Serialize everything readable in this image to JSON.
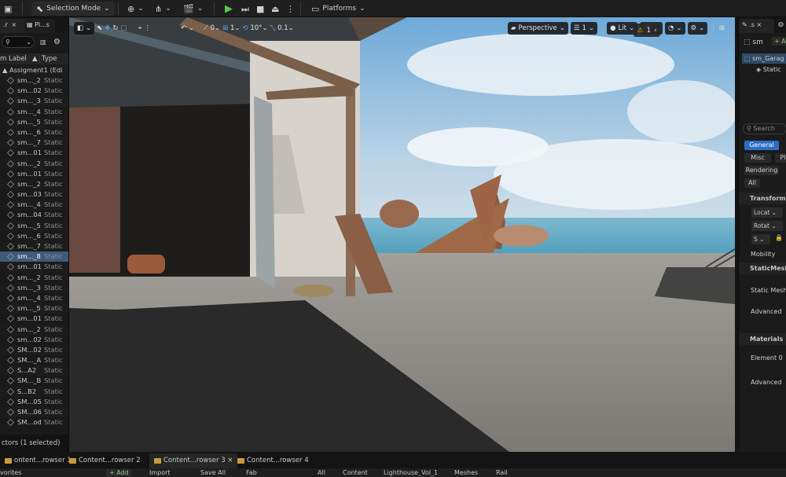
{
  "toolbar": {
    "selection_mode": "Selection Mode",
    "platforms": "Platforms"
  },
  "outliner": {
    "tabs": [
      ".r",
      "Pl...s"
    ],
    "close": "×",
    "search_placeholder": "",
    "column_label": "m Label",
    "column_type": "Type",
    "root": "Assigment1 (Edi",
    "rows": [
      {
        "name": "sm..._2",
        "type": "Static"
      },
      {
        "name": "sm...02",
        "type": "Static"
      },
      {
        "name": "sm..._3",
        "type": "Static"
      },
      {
        "name": "sm..._4",
        "type": "Static"
      },
      {
        "name": "sm..._5",
        "type": "Static"
      },
      {
        "name": "sm..._6",
        "type": "Static"
      },
      {
        "name": "sm..._7",
        "type": "Static"
      },
      {
        "name": "sm...01",
        "type": "Static"
      },
      {
        "name": "sm..._2",
        "type": "Static"
      },
      {
        "name": "sm...01",
        "type": "Static"
      },
      {
        "name": "sm..._2",
        "type": "Static"
      },
      {
        "name": "sm...03",
        "type": "Static"
      },
      {
        "name": "sm..._4",
        "type": "Static"
      },
      {
        "name": "sm...04",
        "type": "Static"
      },
      {
        "name": "sm..._5",
        "type": "Static"
      },
      {
        "name": "sm..._6",
        "type": "Static"
      },
      {
        "name": "sm..._7",
        "type": "Static"
      },
      {
        "name": "sm..._8",
        "type": "Static",
        "selected": true
      },
      {
        "name": "sm...01",
        "type": "Static"
      },
      {
        "name": "sm..._2",
        "type": "Static"
      },
      {
        "name": "sm..._3",
        "type": "Static"
      },
      {
        "name": "sm..._4",
        "type": "Static"
      },
      {
        "name": "sm..._5",
        "type": "Static"
      },
      {
        "name": "sm...01",
        "type": "Static"
      },
      {
        "name": "sm..._2",
        "type": "Static"
      },
      {
        "name": "sm...02",
        "type": "Static"
      },
      {
        "name": "SM...02",
        "type": "Static"
      },
      {
        "name": "SM..._A",
        "type": "Static"
      },
      {
        "name": "S...A2",
        "type": "Static"
      },
      {
        "name": "SM..._B",
        "type": "Static"
      },
      {
        "name": "S...B2",
        "type": "Static"
      },
      {
        "name": "SM...05",
        "type": "Static"
      },
      {
        "name": "SM...06",
        "type": "Static"
      },
      {
        "name": "SM...od",
        "type": "Static"
      }
    ],
    "status": "ctors (1 selected)"
  },
  "viewport": {
    "grid_snap": "1",
    "rot_snap": "10°",
    "scale_snap": "0.1",
    "view_mode_a": "0",
    "perspective": "Perspective",
    "lit": "Lit",
    "layers": "1",
    "warnings": "1"
  },
  "details": {
    "tabs": [
      ".s"
    ],
    "actor_name": "sm",
    "add_label": "+ A",
    "component_root": "sm_Garag",
    "component_child": "Static",
    "search_placeholder": "Search",
    "filters": [
      "General",
      "Misc",
      "Pl",
      "Rendering",
      "All"
    ],
    "sections": {
      "transform": "Transform",
      "static_mesh": "StaticMesh",
      "advanced1": "Advanced",
      "materials": "Materials",
      "advanced2": "Advanced"
    },
    "fields": {
      "location": "Locat",
      "rotation": "Rotat",
      "scale": "S",
      "mobility": "Mobility",
      "static_mesh": "Static Mesh",
      "element0": "Element 0"
    }
  },
  "bottom_tabs": [
    {
      "label": "ontent...rowser 1",
      "active": false
    },
    {
      "label": "Content...rowser 2",
      "active": false
    },
    {
      "label": "Content...rowser 3",
      "active": true
    },
    {
      "label": "Content...rowser 4",
      "active": false
    }
  ],
  "content_browser": {
    "favorites": "vorites",
    "add": "+ Add",
    "import": "Import",
    "save_all": "Save All",
    "fab": "Fab",
    "path": [
      "All",
      "Content",
      "Lighthouse_Vol_1",
      "Meshes",
      "Rail"
    ]
  }
}
